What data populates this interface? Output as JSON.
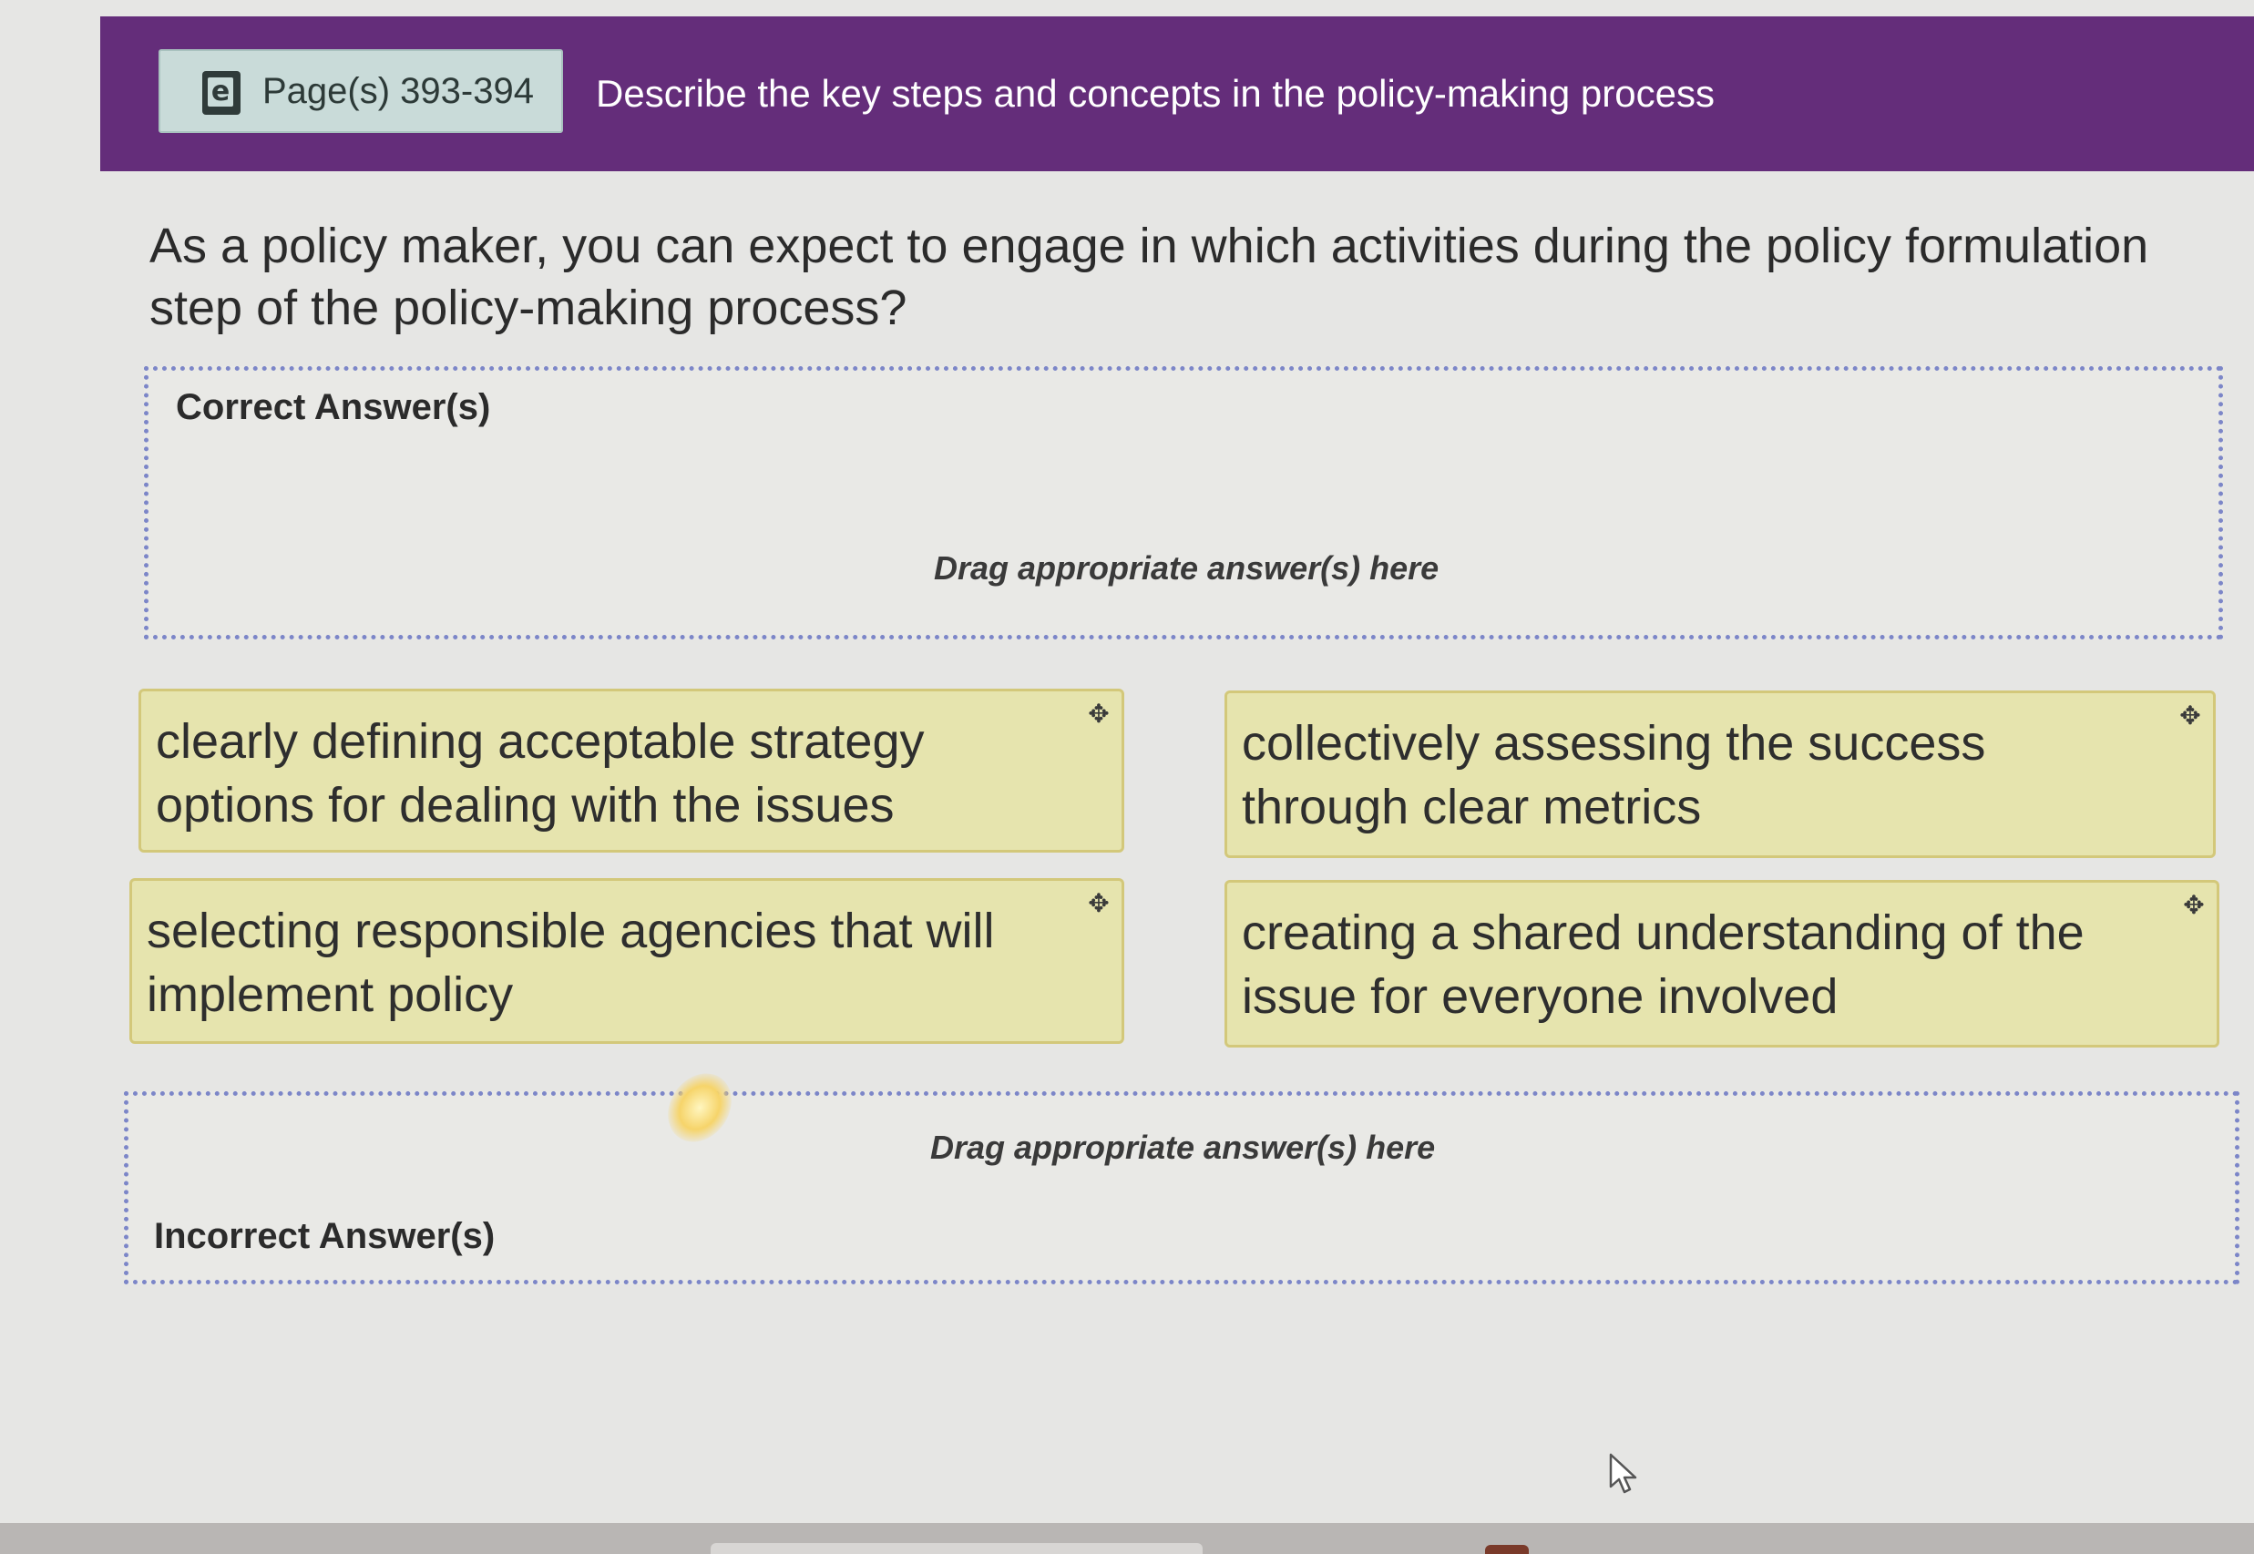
{
  "header": {
    "page_ref": "Page(s) 393-394",
    "ebook_icon": "ebook-icon",
    "objective": "Describe the key steps and concepts in the policy-making process"
  },
  "question": "As a policy maker, you can expect to engage in which activities during the policy formulation step of the policy-making process?",
  "correct_zone": {
    "title": "Correct Answer(s)",
    "hint": "Drag appropriate answer(s) here"
  },
  "incorrect_zone": {
    "title": "Incorrect Answer(s)",
    "hint": "Drag appropriate answer(s) here"
  },
  "answers": [
    {
      "text": "clearly defining acceptable strategy options for dealing with the issues",
      "icon": "move-icon"
    },
    {
      "text": "collectively assessing the success through clear metrics",
      "icon": "move-icon"
    },
    {
      "text": "selecting responsible agencies that will implement policy",
      "icon": "move-icon"
    },
    {
      "text": "creating a shared understanding of the issue for everyone involved",
      "icon": "move-icon"
    }
  ],
  "colors": {
    "header_bg": "#642d7a",
    "badge_bg": "#c9dbd9",
    "tile_bg": "#e6e4ae",
    "dropzone_border": "#7c86c8"
  }
}
